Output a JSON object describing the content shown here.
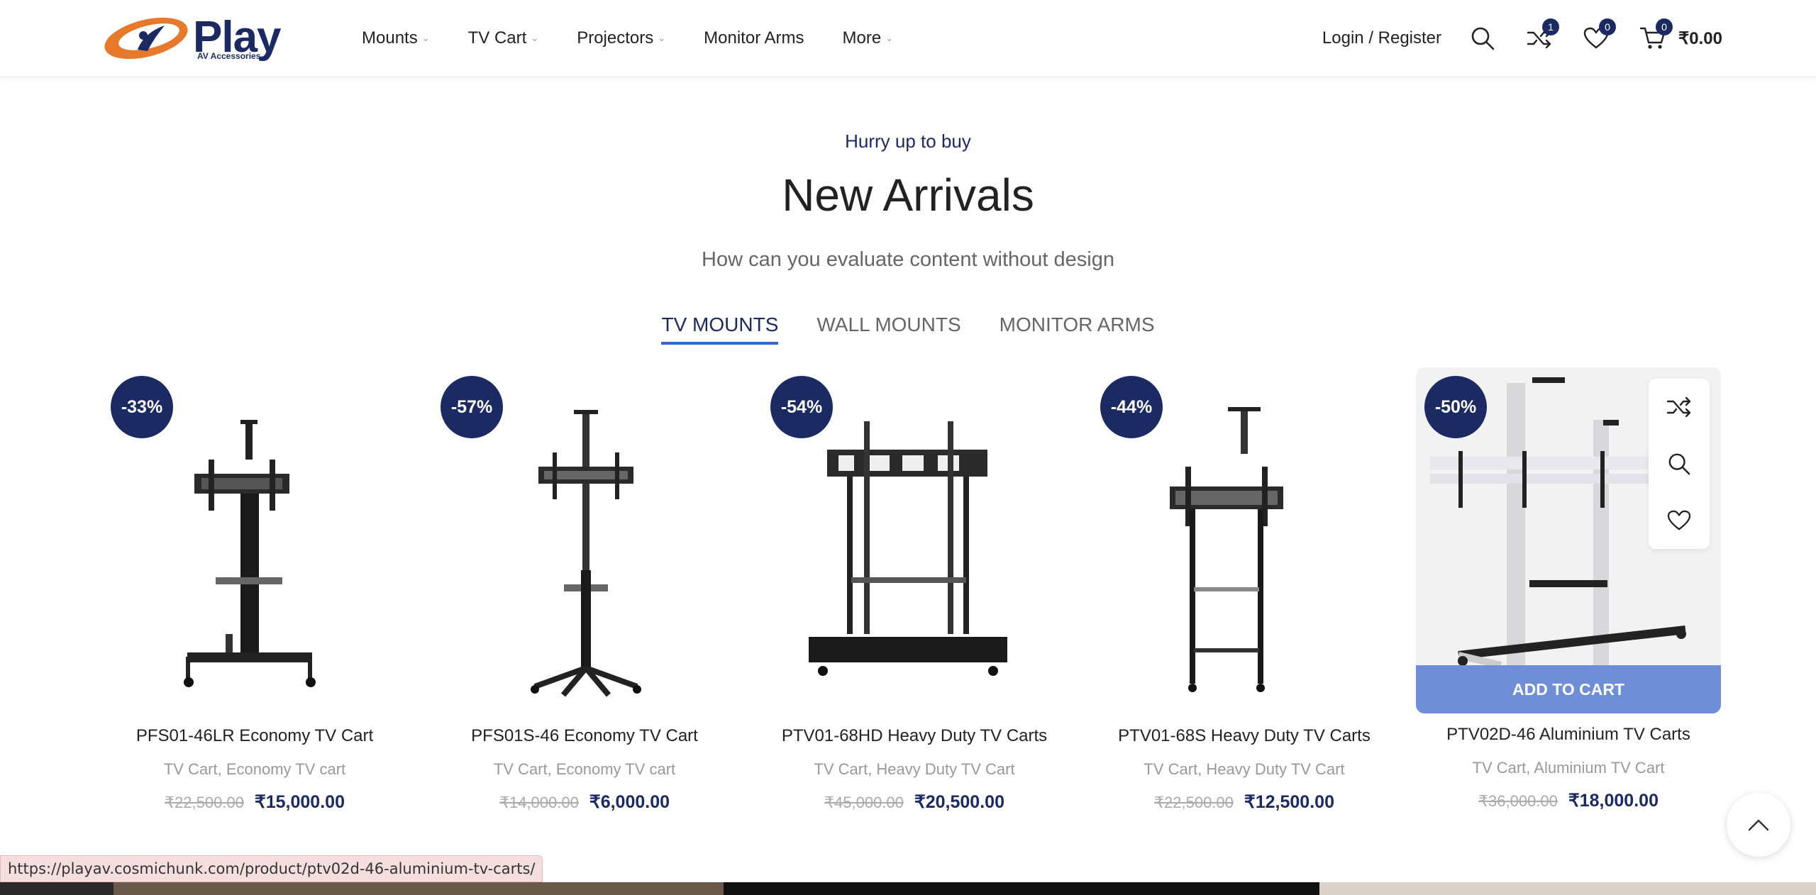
{
  "header": {
    "logo_word": "Play",
    "logo_sub": "AV Accessories",
    "nav": [
      {
        "label": "Mounts",
        "dropdown": true
      },
      {
        "label": "TV Cart",
        "dropdown": true
      },
      {
        "label": "Projectors",
        "dropdown": true
      },
      {
        "label": "Monitor Arms",
        "dropdown": false
      },
      {
        "label": "More",
        "dropdown": true
      }
    ],
    "login_label": "Login / Register",
    "compare_count": "1",
    "wishlist_count": "0",
    "cart_count": "0",
    "cart_total": "₹0.00"
  },
  "section": {
    "kicker": "Hurry up to buy",
    "title": "New Arrivals",
    "subtitle": "How can you evaluate content without design",
    "tabs": [
      {
        "label": "TV MOUNTS",
        "active": true
      },
      {
        "label": "WALL MOUNTS",
        "active": false
      },
      {
        "label": "MONITOR ARMS",
        "active": false
      }
    ]
  },
  "products": [
    {
      "badge": "-33%",
      "name": "PFS01-46LR Economy TV Cart",
      "categories": "TV Cart, Economy TV cart",
      "old_price": "₹22,500.00",
      "price": "₹15,000.00"
    },
    {
      "badge": "-57%",
      "name": "PFS01S-46 Economy TV Cart",
      "categories": "TV Cart, Economy TV cart",
      "old_price": "₹14,000.00",
      "price": "₹6,000.00"
    },
    {
      "badge": "-54%",
      "name": "PTV01-68HD Heavy Duty TV Carts",
      "categories": "TV Cart, Heavy Duty TV Cart",
      "old_price": "₹45,000.00",
      "price": "₹20,500.00"
    },
    {
      "badge": "-44%",
      "name": "PTV01-68S Heavy Duty TV Carts",
      "categories": "TV Cart, Heavy Duty TV Cart",
      "old_price": "₹22,500.00",
      "price": "₹12,500.00"
    },
    {
      "badge": "-50%",
      "name": "PTV02D-46 Aluminium TV Carts",
      "categories": "TV Cart, Aluminium TV Cart",
      "old_price": "₹36,000.00",
      "price": "₹18,000.00",
      "add_to_cart": "ADD TO CART"
    }
  ],
  "status_bar_url": "https://playav.cosmichunk.com/product/ptv02d-46-aluminium-tv-carts/",
  "colors": {
    "brand_navy": "#1c2a63",
    "brand_orange": "#e8782a",
    "tab_underline": "#3468c8",
    "add_to_cart": "#6e8fd8"
  }
}
